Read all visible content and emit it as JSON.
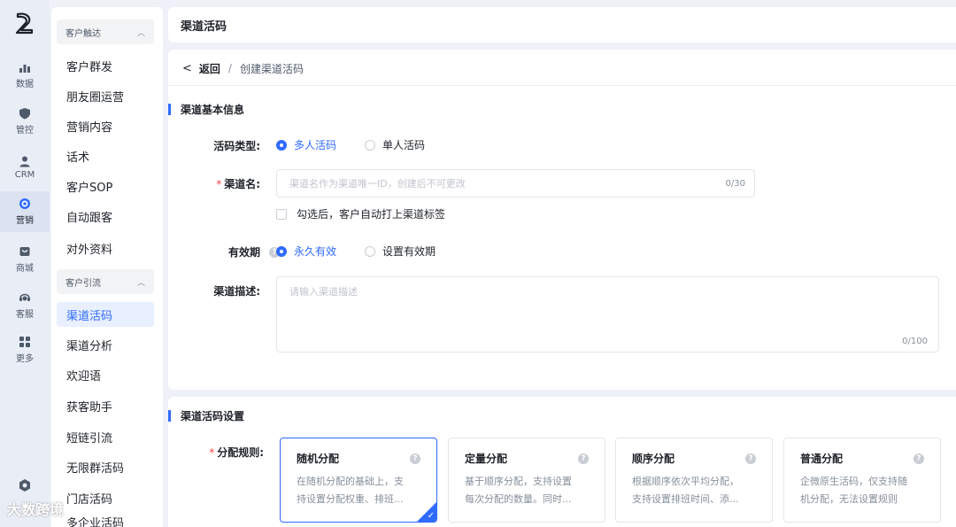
{
  "rail": {
    "items": [
      {
        "label": "数据",
        "icon": "chart-icon"
      },
      {
        "label": "管控",
        "icon": "shield-icon"
      },
      {
        "label": "CRM",
        "icon": "user-icon"
      },
      {
        "label": "营销",
        "icon": "target-icon"
      },
      {
        "label": "商城",
        "icon": "shop-icon"
      },
      {
        "label": "客服",
        "icon": "headset-icon"
      },
      {
        "label": "更多",
        "icon": "grid-icon"
      }
    ],
    "active": "营销"
  },
  "sidebar": {
    "group1": "客户触达",
    "group1_items": [
      "客户群发",
      "朋友圈运营",
      "营销内容",
      "话术",
      "客户SOP",
      "自动跟客",
      "对外资料"
    ],
    "group2": "客户引流",
    "group2_items": [
      "渠道活码",
      "渠道分析",
      "欢迎语",
      "获客助手",
      "短链引流",
      "无限群活码",
      "门店活码",
      "多企业活码"
    ],
    "active": "渠道活码"
  },
  "topbar": {
    "title": "渠道活码"
  },
  "breadcrumb": {
    "back": "返回",
    "sep": "/",
    "current": "创建渠道活码"
  },
  "basic": {
    "title": "渠道基本信息",
    "code_type_label": "活码类型:",
    "code_type_options": [
      "多人活码",
      "单人活码"
    ],
    "channel_name_label": "渠道名:",
    "channel_name_placeholder": "渠道名作为渠道唯一ID，创建后不可更改",
    "channel_name_count": "0/30",
    "auto_tag_label": "勾选后，客户自动打上渠道标签",
    "validity_label": "有效期",
    "validity_options": [
      "永久有效",
      "设置有效期"
    ],
    "desc_label": "渠道描述:",
    "desc_placeholder": "请输入渠道描述",
    "desc_count": "0/100"
  },
  "settings": {
    "title": "渠道活码设置",
    "rule_label": "分配规则:",
    "rules": [
      {
        "name": "随机分配",
        "line1": "在随机分配的基础上，支",
        "line2": "持设置分配权重、排班..."
      },
      {
        "name": "定量分配",
        "line1": "基于顺序分配，支持设置",
        "line2": "每次分配的数量。同时..."
      },
      {
        "name": "顺序分配",
        "line1": "根据顺序依次平均分配，",
        "line2": "支持设置排班时间、添..."
      },
      {
        "name": "普通分配",
        "line1": "企微原生活码，仅支持随",
        "line2": "机分配，无法设置规则"
      }
    ]
  },
  "footer_logo": "大数跨境",
  "colors": {
    "accent": "#2f6bff",
    "required": "#f53f3f"
  }
}
